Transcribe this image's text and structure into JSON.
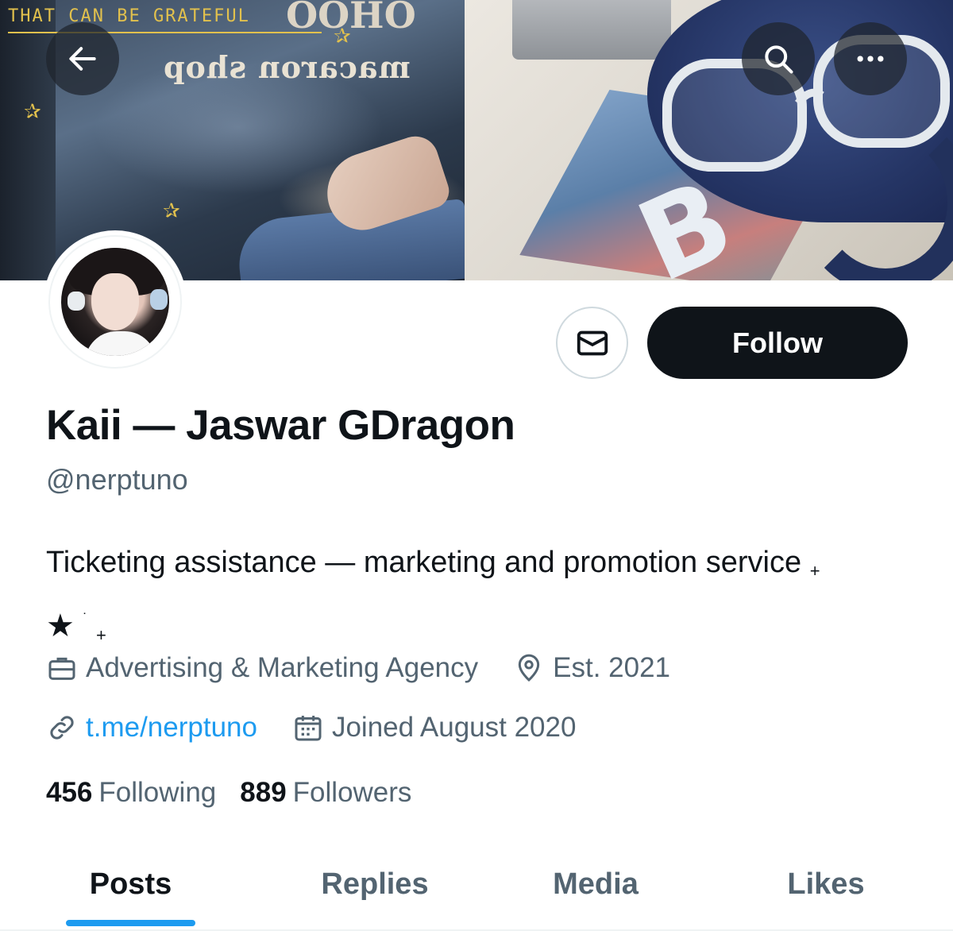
{
  "banner": {
    "scribble_text": "THAT CAN BE GRATEFUL",
    "sign_text": "macaron shop",
    "sign_top_text": "OHOO",
    "book_letter": "B"
  },
  "nav": {
    "back_icon": "arrow-left-icon",
    "search_icon": "search-icon",
    "more_icon": "more-horizontal-icon"
  },
  "profile": {
    "display_name": "Kaii — Jaswar GDragon",
    "handle": "@nerptuno",
    "bio_line1": "Ticketing assistance — marketing and promotion service",
    "bio_plus1": "+",
    "bio_star": "★",
    "bio_dot": "˙",
    "bio_plus2": "+",
    "category": "Advertising & Marketing Agency",
    "location": "Est. 2021",
    "website": "t.me/nerptuno",
    "joined": "Joined August 2020",
    "following_count": "456",
    "following_label": "Following",
    "followers_count": "889",
    "followers_label": "Followers"
  },
  "actions": {
    "message_icon": "envelope-icon",
    "follow_label": "Follow"
  },
  "tabs": [
    {
      "label": "Posts",
      "active": true
    },
    {
      "label": "Replies",
      "active": false
    },
    {
      "label": "Media",
      "active": false
    },
    {
      "label": "Likes",
      "active": false
    }
  ],
  "colors": {
    "accent": "#1d9bf0",
    "text_primary": "#0f1419",
    "text_secondary": "#536471",
    "button_dark": "#0f1419"
  }
}
